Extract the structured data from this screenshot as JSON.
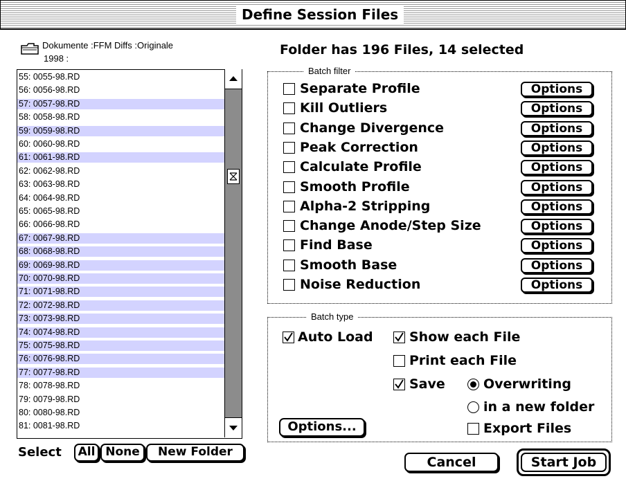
{
  "window": {
    "title": "Define Session Files"
  },
  "path": {
    "line1": "Dokumente :FFM Diffs :Originale",
    "line2": "1998 :",
    "icon": "folder-icon"
  },
  "status": {
    "folder_info": "Folder has 196 Files, 14 selected"
  },
  "files": [
    {
      "label": "55: 0055-98.RD",
      "selected": false
    },
    {
      "label": "56: 0056-98.RD",
      "selected": false
    },
    {
      "label": "57: 0057-98.RD",
      "selected": true
    },
    {
      "label": "58: 0058-98.RD",
      "selected": false
    },
    {
      "label": "59: 0059-98.RD",
      "selected": true
    },
    {
      "label": "60: 0060-98.RD",
      "selected": false
    },
    {
      "label": "61: 0061-98.RD",
      "selected": true
    },
    {
      "label": "62: 0062-98.RD",
      "selected": false
    },
    {
      "label": "63: 0063-98.RD",
      "selected": false
    },
    {
      "label": "64: 0064-98.RD",
      "selected": false
    },
    {
      "label": "65: 0065-98.RD",
      "selected": false
    },
    {
      "label": "66: 0066-98.RD",
      "selected": false
    },
    {
      "label": "67: 0067-98.RD",
      "selected": true
    },
    {
      "label": "68: 0068-98.RD",
      "selected": true
    },
    {
      "label": "69: 0069-98.RD",
      "selected": true
    },
    {
      "label": "70: 0070-98.RD",
      "selected": true
    },
    {
      "label": "71: 0071-98.RD",
      "selected": true
    },
    {
      "label": "72: 0072-98.RD",
      "selected": true
    },
    {
      "label": "73: 0073-98.RD",
      "selected": true
    },
    {
      "label": "74: 0074-98.RD",
      "selected": true
    },
    {
      "label": "75: 0075-98.RD",
      "selected": true
    },
    {
      "label": "76: 0076-98.RD",
      "selected": true
    },
    {
      "label": "77: 0077-98.RD",
      "selected": true
    },
    {
      "label": "78: 0078-98.RD",
      "selected": false
    },
    {
      "label": "79: 0079-98.RD",
      "selected": false
    },
    {
      "label": "80: 0080-98.RD",
      "selected": false
    },
    {
      "label": "81: 0081-98.RD",
      "selected": false
    }
  ],
  "select_bar": {
    "label": "Select",
    "all": "All",
    "none": "None",
    "new_folder": "New Folder"
  },
  "batch_filter": {
    "title": "Batch filter",
    "options_label": "Options",
    "items": [
      {
        "label": "Separate Profile",
        "checked": false
      },
      {
        "label": "Kill Outliers",
        "checked": false
      },
      {
        "label": "Change Divergence",
        "checked": false
      },
      {
        "label": "Peak Correction",
        "checked": false
      },
      {
        "label": "Calculate Profile",
        "checked": false
      },
      {
        "label": "Smooth Profile",
        "checked": false
      },
      {
        "label": "Alpha-2 Stripping",
        "checked": false
      },
      {
        "label": "Change Anode/Step Size",
        "checked": false
      },
      {
        "label": "Find Base",
        "checked": false
      },
      {
        "label": "Smooth Base",
        "checked": false
      },
      {
        "label": "Noise Reduction",
        "checked": false
      }
    ]
  },
  "batch_type": {
    "title": "Batch type",
    "auto_load": {
      "label": "Auto Load",
      "checked": true
    },
    "show_each": {
      "label": "Show each File",
      "checked": true
    },
    "print_each": {
      "label": "Print each File",
      "checked": false
    },
    "save": {
      "label": "Save",
      "checked": true
    },
    "overwriting": {
      "label": "Overwriting",
      "selected": true
    },
    "new_folder": {
      "label": "in a new folder",
      "selected": false
    },
    "export": {
      "label": "Export Files",
      "checked": false
    },
    "options_button": "Options..."
  },
  "footer": {
    "cancel": "Cancel",
    "start": "Start Job"
  }
}
